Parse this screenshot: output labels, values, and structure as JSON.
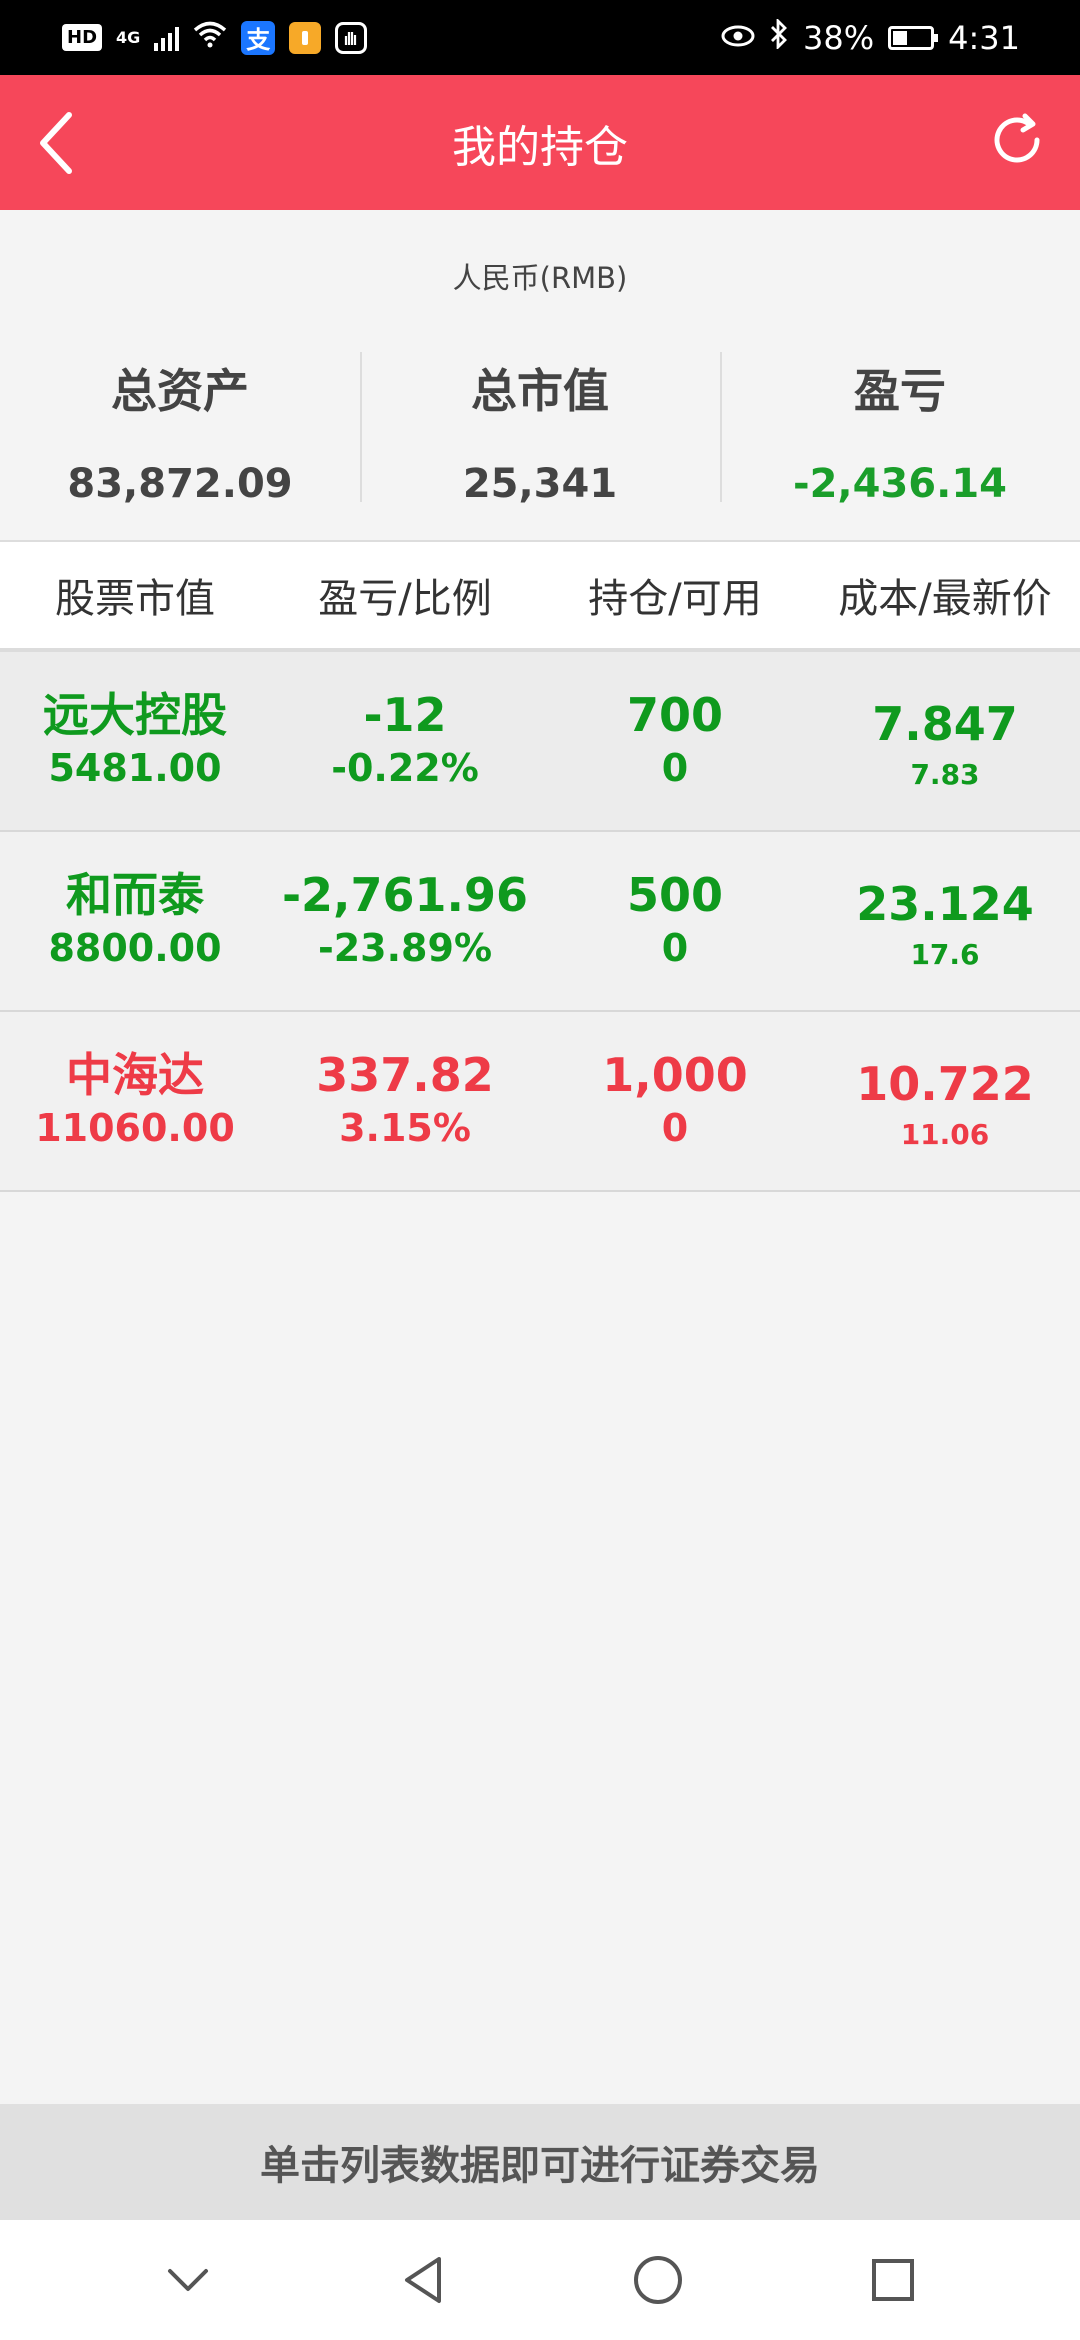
{
  "status_bar": {
    "hd": "HD",
    "network": "4G",
    "alipay_glyph": "支",
    "battery_percent": "38%",
    "battery_level": 0.38,
    "time": "4:31",
    "icons": [
      "signal-icon",
      "wifi-icon",
      "alipay-icon",
      "app-icon",
      "hand-icon",
      "eye-icon",
      "bluetooth-icon",
      "battery-icon"
    ]
  },
  "header": {
    "title": "我的持仓",
    "back_icon": "chevron-left-icon",
    "refresh_icon": "refresh-icon",
    "background": "#f6475a"
  },
  "summary": {
    "currency": "人民币(RMB)",
    "items": [
      {
        "label": "总资产",
        "value": "83,872.09"
      },
      {
        "label": "总市值",
        "value": "25,341"
      },
      {
        "label": "盈亏",
        "value": "-2,436.14"
      }
    ]
  },
  "table": {
    "headers": [
      "股票市值",
      "盈亏/比例",
      "持仓/可用",
      "成本/最新价"
    ],
    "rows": [
      {
        "name": "远大控股",
        "market_value": "5481.00",
        "pnl": "-12",
        "pnl_ratio": "-0.22%",
        "position": "700",
        "available": "0",
        "cost": "7.847",
        "latest": "7.83",
        "trend": "down"
      },
      {
        "name": "和而泰",
        "market_value": "8800.00",
        "pnl": "-2,761.96",
        "pnl_ratio": "-23.89%",
        "position": "500",
        "available": "0",
        "cost": "23.124",
        "latest": "17.6",
        "trend": "down"
      },
      {
        "name": "中海达",
        "market_value": "11060.00",
        "pnl": "337.82",
        "pnl_ratio": "3.15%",
        "position": "1,000",
        "available": "0",
        "cost": "10.722",
        "latest": "11.06",
        "trend": "up"
      }
    ]
  },
  "footer": {
    "hint": "单击列表数据即可进行证券交易"
  },
  "nav_bar": {
    "icons": [
      "chevron-down-icon",
      "back-triangle-icon",
      "home-circle-icon",
      "recents-square-icon"
    ]
  },
  "colors": {
    "loss_green": "#0f9a1e",
    "gain_red": "#ee3b47"
  }
}
